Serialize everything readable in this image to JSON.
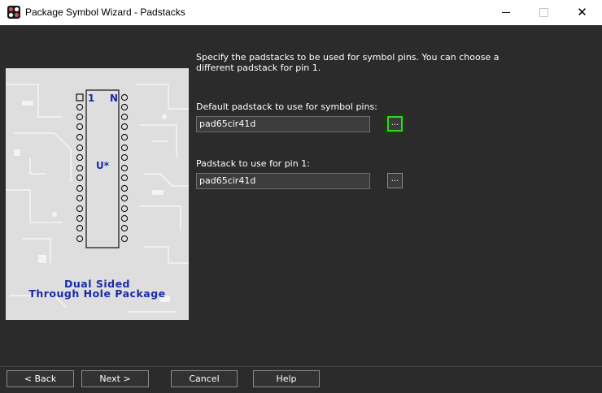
{
  "window": {
    "title": "Package Symbol Wizard - Padstacks",
    "close_glyph": "✕"
  },
  "preview": {
    "pin1_label": "1",
    "pinN_label": "N",
    "refdes_label": "U*",
    "caption_line1": "Dual Sided",
    "caption_line2": "Through Hole Package"
  },
  "form": {
    "description": "Specify the padstacks to be used for symbol pins. You can choose a different padstack for pin 1.",
    "default_label": "Default padstack to use for symbol pins:",
    "default_value": "pad65cir41d",
    "pin1_label": "Padstack to use for pin 1:",
    "pin1_value": "pad65cir41d",
    "browse_label": "..."
  },
  "buttons": {
    "back": "< Back",
    "next": "Next >",
    "cancel": "Cancel",
    "help": "Help"
  },
  "colors": {
    "background": "#2b2b2b",
    "focus_highlight": "#39d12c",
    "package_text": "#1b2aa8"
  }
}
